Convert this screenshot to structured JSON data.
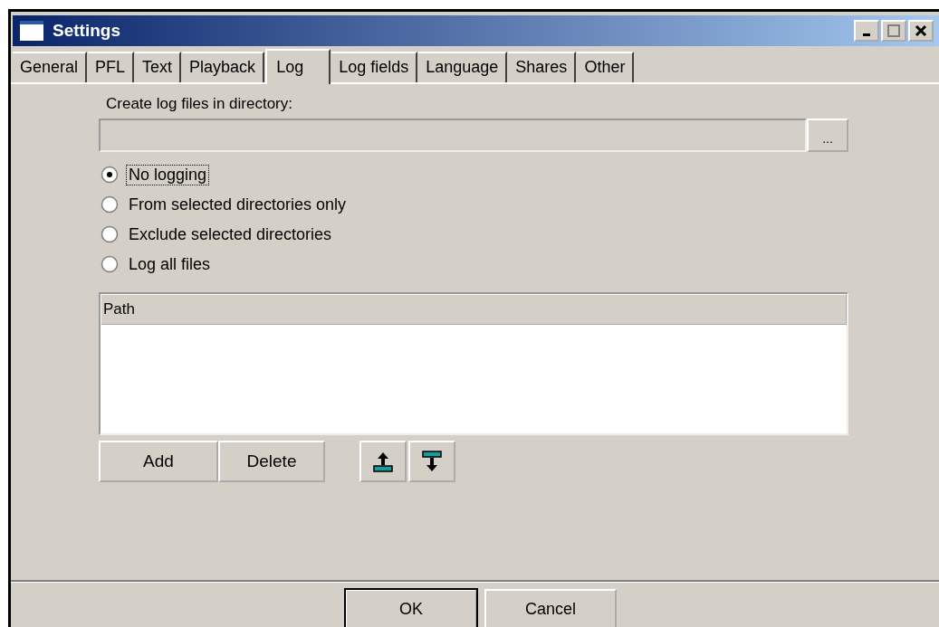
{
  "window": {
    "title": "Settings"
  },
  "tabs": [
    {
      "label": "General",
      "selected": false
    },
    {
      "label": "PFL",
      "selected": false
    },
    {
      "label": "Text",
      "selected": false
    },
    {
      "label": "Playback",
      "selected": false
    },
    {
      "label": "Log",
      "selected": true
    },
    {
      "label": "Log fields",
      "selected": false
    },
    {
      "label": "Language",
      "selected": false
    },
    {
      "label": "Shares",
      "selected": false
    },
    {
      "label": "Other",
      "selected": false
    }
  ],
  "directory": {
    "label": "Create log files in directory:",
    "disabled": true,
    "browse_button": "..."
  },
  "logging_options": [
    {
      "label": "No logging",
      "selected": true,
      "focused": true
    },
    {
      "label": "From selected directories only",
      "selected": false,
      "focused": false
    },
    {
      "label": "Exclude selected directories",
      "selected": false,
      "focused": false
    },
    {
      "label": "Log all files",
      "selected": false,
      "focused": false
    }
  ],
  "directory_list": {
    "columns": [
      "Path"
    ]
  },
  "list_buttons": [
    "Add",
    "Delete"
  ],
  "dialog_buttons": [
    {
      "label": "OK",
      "default": true
    },
    {
      "label": "Cancel",
      "default": false
    }
  ]
}
